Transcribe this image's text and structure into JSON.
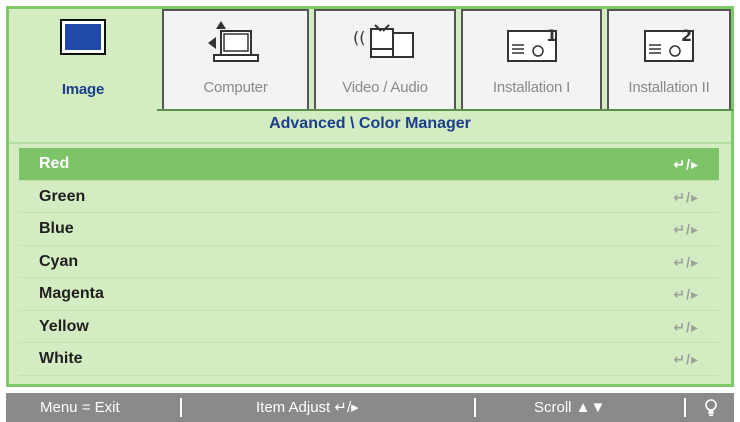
{
  "tabs": [
    {
      "label": "Image",
      "icon": "monitor-icon",
      "active": true
    },
    {
      "label": "Computer",
      "icon": "computer-icon",
      "active": false
    },
    {
      "label": "Video / Audio",
      "icon": "video-audio-icon",
      "active": false
    },
    {
      "label": "Installation I",
      "icon": "projector-1-icon",
      "active": false
    },
    {
      "label": "Installation II",
      "icon": "projector-2-icon",
      "active": false
    }
  ],
  "breadcrumb": "Advanced \\ Color Manager",
  "menu": {
    "items": [
      {
        "label": "Red",
        "action": "↵/▸",
        "selected": true
      },
      {
        "label": "Green",
        "action": "↵/▸",
        "selected": false
      },
      {
        "label": "Blue",
        "action": "↵/▸",
        "selected": false
      },
      {
        "label": "Cyan",
        "action": "↵/▸",
        "selected": false
      },
      {
        "label": "Magenta",
        "action": "↵/▸",
        "selected": false
      },
      {
        "label": "Yellow",
        "action": "↵/▸",
        "selected": false
      },
      {
        "label": "White",
        "action": "↵/▸",
        "selected": false
      }
    ]
  },
  "footer": {
    "menu_exit": "Menu = Exit",
    "item_adjust": "Item Adjust ↵/▸",
    "scroll": "Scroll ▲▼",
    "tip_icon": "lightbulb-icon"
  },
  "colors": {
    "panel_bg": "#d4ecc1",
    "accent_green": "#7cc467",
    "title_blue": "#1b3f8a",
    "footer_gray": "#8a8a8a"
  }
}
